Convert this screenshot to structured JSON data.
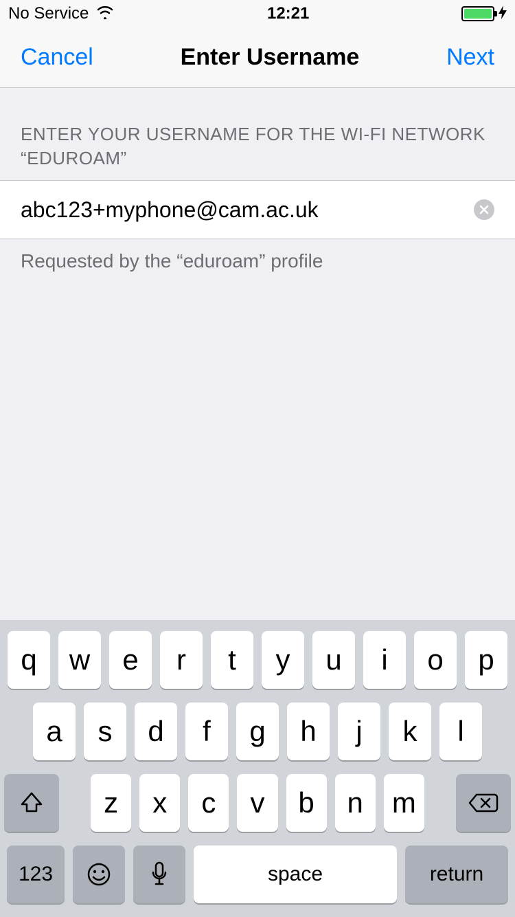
{
  "status_bar": {
    "carrier": "No Service",
    "time": "12:21"
  },
  "nav": {
    "left": "Cancel",
    "title": "Enter Username",
    "right": "Next"
  },
  "section": {
    "header": "ENTER YOUR USERNAME FOR THE WI-FI NETWORK “EDUROAM”",
    "footer": "Requested by the “eduroam” profile"
  },
  "input": {
    "value": "abc123+myphone@cam.ac.uk"
  },
  "keyboard": {
    "row1": [
      "q",
      "w",
      "e",
      "r",
      "t",
      "y",
      "u",
      "i",
      "o",
      "p"
    ],
    "row2": [
      "a",
      "s",
      "d",
      "f",
      "g",
      "h",
      "j",
      "k",
      "l"
    ],
    "row3": [
      "z",
      "x",
      "c",
      "v",
      "b",
      "n",
      "m"
    ],
    "numbers_label": "123",
    "space_label": "space",
    "return_label": "return"
  }
}
